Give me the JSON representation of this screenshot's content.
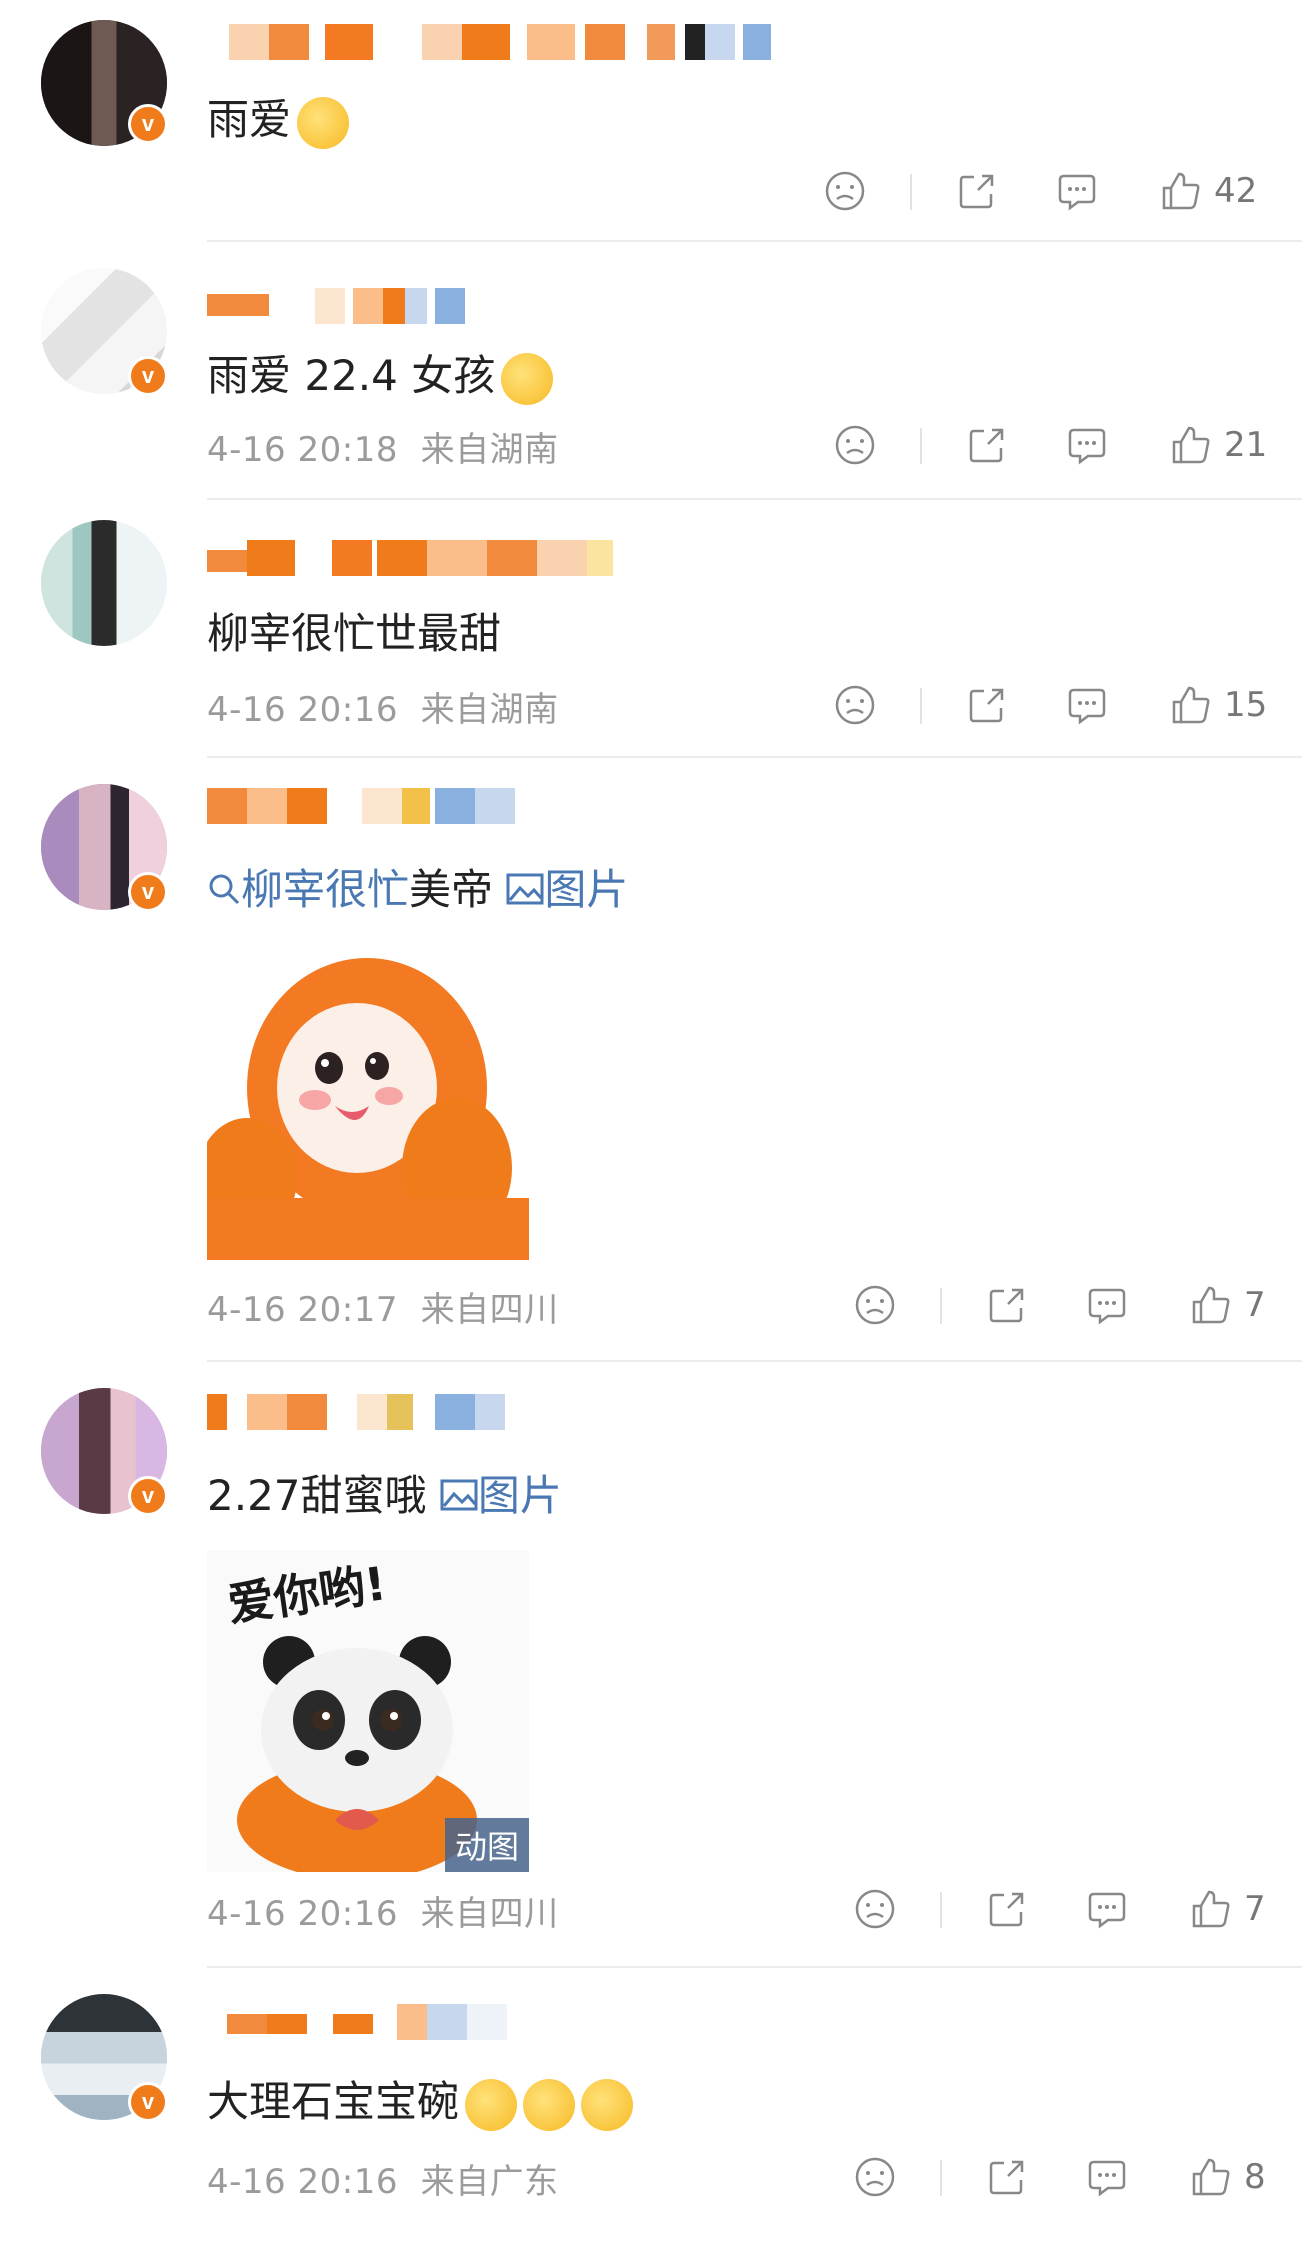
{
  "comments": [
    {
      "text": "雨爱",
      "time": "",
      "location": "",
      "likes": "42",
      "emoji": [
        "heart-kiss-emoji"
      ]
    },
    {
      "text": "雨爱 22.4 女孩",
      "time": "4-16 20:18",
      "location": "来自湖南",
      "likes": "21",
      "emoji": [
        "shy-emoji"
      ]
    },
    {
      "text": "柳宰很忙世最甜",
      "time": "4-16 20:16",
      "location": "来自湖南",
      "likes": "15"
    },
    {
      "search_link": "柳宰很忙",
      "text_after": "美帝",
      "image_link": "图片",
      "time": "4-16 20:17",
      "location": "来自四川",
      "likes": "7",
      "sticker": "orange-monkey-sticker"
    },
    {
      "text": "2.27甜蜜哦",
      "image_link": "图片",
      "time": "4-16 20:16",
      "location": "来自四川",
      "likes": "7",
      "sticker": "panda-love-sticker",
      "sticker_text": "爱你哟!",
      "gif_badge": "动图"
    },
    {
      "text": "大理石宝宝碗",
      "time": "4-16 20:16",
      "location": "来自广东",
      "likes": "8",
      "emoji": [
        "pray-emoji",
        "pray-emoji",
        "pray-emoji"
      ]
    }
  ],
  "colors": {
    "accent": "#f07b1a",
    "link": "#4a78b3",
    "meta": "#9b9b9b"
  }
}
